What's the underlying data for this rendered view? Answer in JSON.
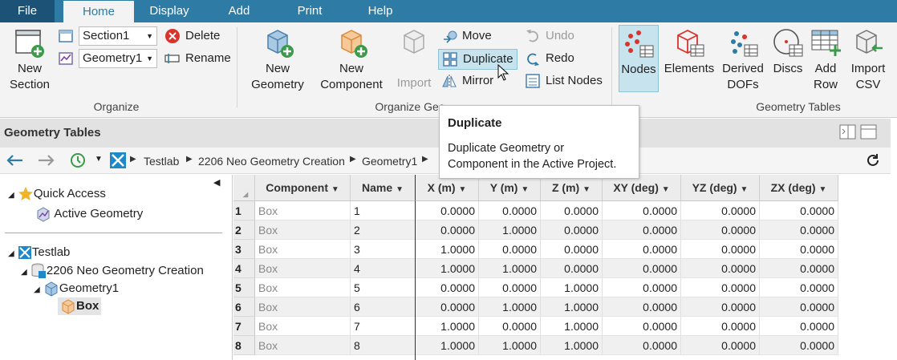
{
  "tabs": {
    "file": "File",
    "home": "Home",
    "display": "Display",
    "add": "Add",
    "print": "Print",
    "help": "Help"
  },
  "organize": {
    "new_section": [
      "New",
      "Section"
    ],
    "section_combo": "Section1",
    "geometry_combo": "Geometry1",
    "delete": "Delete",
    "rename": "Rename",
    "group_label": "Organize"
  },
  "organize_geometry": {
    "new_geometry": [
      "New",
      "Geometry"
    ],
    "new_component": [
      "New",
      "Component"
    ],
    "import": "Import",
    "move": "Move",
    "duplicate": "Duplicate",
    "mirror": "Mirror",
    "undo": "Undo",
    "redo": "Redo",
    "list_nodes": "List Nodes",
    "group_label": "Organize Geo"
  },
  "geometry_tables": {
    "nodes": "Nodes",
    "elements": "Elements",
    "derived_dofs": [
      "Derived",
      "DOFs"
    ],
    "discs": "Discs",
    "add_row": [
      "Add",
      "Row"
    ],
    "import_csv": [
      "Import",
      "CSV"
    ],
    "group_label": "Geometry Tables"
  },
  "tooltip": {
    "title": "Duplicate",
    "line1": "Duplicate Geometry or",
    "line2": "Component in the Active Project."
  },
  "panel": {
    "title": "Geometry Tables"
  },
  "breadcrumb": [
    "Testlab",
    "2206 Neo Geometry Creation",
    "Geometry1"
  ],
  "tree": {
    "quick_access": "Quick Access",
    "active_geometry": "Active Geometry",
    "testlab": "Testlab",
    "project": "2206 Neo Geometry Creation",
    "geometry": "Geometry1",
    "component": "Box"
  },
  "table": {
    "columns": [
      "Component",
      "Name",
      "X (m)",
      "Y (m)",
      "Z (m)",
      "XY (deg)",
      "YZ (deg)",
      "ZX (deg)"
    ],
    "rows": [
      [
        "1",
        "Box",
        "1",
        "0.0000",
        "0.0000",
        "0.0000",
        "0.0000",
        "0.0000",
        "0.0000"
      ],
      [
        "2",
        "Box",
        "2",
        "0.0000",
        "1.0000",
        "0.0000",
        "0.0000",
        "0.0000",
        "0.0000"
      ],
      [
        "3",
        "Box",
        "3",
        "1.0000",
        "0.0000",
        "0.0000",
        "0.0000",
        "0.0000",
        "0.0000"
      ],
      [
        "4",
        "Box",
        "4",
        "1.0000",
        "1.0000",
        "0.0000",
        "0.0000",
        "0.0000",
        "0.0000"
      ],
      [
        "5",
        "Box",
        "5",
        "0.0000",
        "0.0000",
        "1.0000",
        "0.0000",
        "0.0000",
        "0.0000"
      ],
      [
        "6",
        "Box",
        "6",
        "0.0000",
        "1.0000",
        "1.0000",
        "0.0000",
        "0.0000",
        "0.0000"
      ],
      [
        "7",
        "Box",
        "7",
        "1.0000",
        "0.0000",
        "1.0000",
        "0.0000",
        "0.0000",
        "0.0000"
      ],
      [
        "8",
        "Box",
        "8",
        "1.0000",
        "1.0000",
        "1.0000",
        "0.0000",
        "0.0000",
        "0.0000"
      ]
    ]
  },
  "colors": {
    "tabbar": "#2e7ba5",
    "file_tab": "#1b5276",
    "selected_button": "#c7e3ee",
    "accent": "#2e7ba5"
  }
}
